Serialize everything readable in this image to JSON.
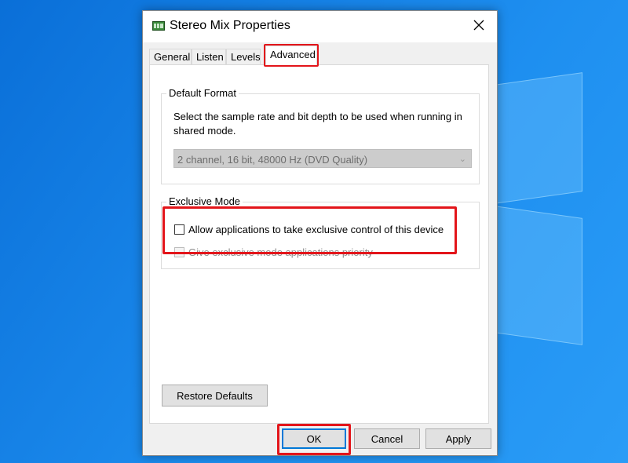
{
  "window": {
    "title": "Stereo Mix Properties",
    "icon": "sound-device-icon",
    "close_icon": "close-icon"
  },
  "tabs": [
    {
      "label": "General",
      "active": false
    },
    {
      "label": "Listen",
      "active": false
    },
    {
      "label": "Levels",
      "active": false
    },
    {
      "label": "Advanced",
      "active": true
    }
  ],
  "default_format": {
    "group_label": "Default Format",
    "description": "Select the sample rate and bit depth to be used when running in shared mode.",
    "selected": "2 channel, 16 bit, 48000 Hz (DVD Quality)",
    "disabled": true
  },
  "exclusive_mode": {
    "group_label": "Exclusive Mode",
    "allow_label": "Allow applications to take exclusive control of this device",
    "allow_checked": false,
    "priority_label": "Give exclusive mode applications priority",
    "priority_checked": false,
    "priority_disabled": true
  },
  "buttons": {
    "restore_defaults": "Restore Defaults",
    "ok": "OK",
    "cancel": "Cancel",
    "apply": "Apply"
  },
  "colors": {
    "highlight": "#e3151a",
    "desktop": "#1682e6",
    "accent": "#0078d7"
  }
}
